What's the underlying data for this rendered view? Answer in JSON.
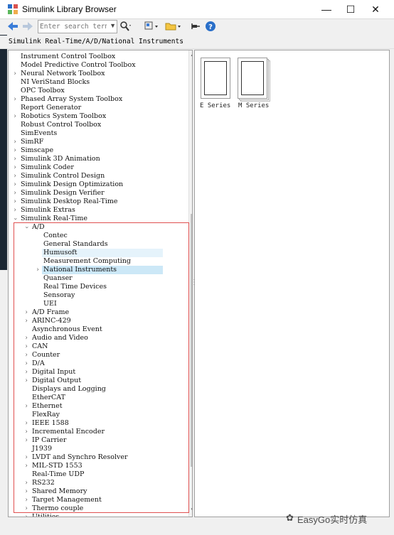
{
  "window": {
    "title": "Simulink Library Browser",
    "minimize": "—",
    "maximize": "☐",
    "close": "✕"
  },
  "toolbar": {
    "search_placeholder": "Enter search term",
    "icons": [
      "back-arrow-icon",
      "forward-arrow-icon",
      "search-options-icon",
      "refresh-icon",
      "folder-icon",
      "pin-icon",
      "help-icon"
    ]
  },
  "path": "Simulink Real-Time/A/D/National Instruments",
  "tree": {
    "items": [
      {
        "label": "Instrument Control Toolbox",
        "level": 0,
        "arrow": "none"
      },
      {
        "label": "Model Predictive Control Toolbox",
        "level": 0,
        "arrow": "none"
      },
      {
        "label": "Neural Network Toolbox",
        "level": 0,
        "arrow": "closed"
      },
      {
        "label": "NI VeriStand Blocks",
        "level": 0,
        "arrow": "none"
      },
      {
        "label": "OPC Toolbox",
        "level": 0,
        "arrow": "none"
      },
      {
        "label": "Phased Array System Toolbox",
        "level": 0,
        "arrow": "closed"
      },
      {
        "label": "Report Generator",
        "level": 0,
        "arrow": "none"
      },
      {
        "label": "Robotics System Toolbox",
        "level": 0,
        "arrow": "closed"
      },
      {
        "label": "Robust Control Toolbox",
        "level": 0,
        "arrow": "none"
      },
      {
        "label": "SimEvents",
        "level": 0,
        "arrow": "none"
      },
      {
        "label": "SimRF",
        "level": 0,
        "arrow": "closed"
      },
      {
        "label": "Simscape",
        "level": 0,
        "arrow": "closed"
      },
      {
        "label": "Simulink 3D Animation",
        "level": 0,
        "arrow": "closed"
      },
      {
        "label": "Simulink Coder",
        "level": 0,
        "arrow": "closed"
      },
      {
        "label": "Simulink Control Design",
        "level": 0,
        "arrow": "closed"
      },
      {
        "label": "Simulink Design Optimization",
        "level": 0,
        "arrow": "closed"
      },
      {
        "label": "Simulink Design Verifier",
        "level": 0,
        "arrow": "closed"
      },
      {
        "label": "Simulink Desktop Real-Time",
        "level": 0,
        "arrow": "closed"
      },
      {
        "label": "Simulink Extras",
        "level": 0,
        "arrow": "closed"
      },
      {
        "label": "Simulink Real-Time",
        "level": 0,
        "arrow": "open"
      },
      {
        "label": "A/D",
        "level": 1,
        "arrow": "open"
      },
      {
        "label": "Contec",
        "level": 2,
        "arrow": "none"
      },
      {
        "label": "General Standards",
        "level": 2,
        "arrow": "none"
      },
      {
        "label": "Humusoft",
        "level": 2,
        "arrow": "none",
        "highlight": "light"
      },
      {
        "label": "Measurement Computing",
        "level": 2,
        "arrow": "none"
      },
      {
        "label": "National Instruments",
        "level": 2,
        "arrow": "closed",
        "highlight": "selected"
      },
      {
        "label": "Quanser",
        "level": 2,
        "arrow": "none"
      },
      {
        "label": "Real Time Devices",
        "level": 2,
        "arrow": "none"
      },
      {
        "label": "Sensoray",
        "level": 2,
        "arrow": "none"
      },
      {
        "label": "UEI",
        "level": 2,
        "arrow": "none"
      },
      {
        "label": "A/D Frame",
        "level": 1,
        "arrow": "closed"
      },
      {
        "label": "ARINC-429",
        "level": 1,
        "arrow": "closed"
      },
      {
        "label": "Asynchronous Event",
        "level": 1,
        "arrow": "none"
      },
      {
        "label": "Audio and Video",
        "level": 1,
        "arrow": "closed"
      },
      {
        "label": "CAN",
        "level": 1,
        "arrow": "closed"
      },
      {
        "label": "Counter",
        "level": 1,
        "arrow": "closed"
      },
      {
        "label": "D/A",
        "level": 1,
        "arrow": "closed"
      },
      {
        "label": "Digital Input",
        "level": 1,
        "arrow": "closed"
      },
      {
        "label": "Digital Output",
        "level": 1,
        "arrow": "closed"
      },
      {
        "label": "Displays and Logging",
        "level": 1,
        "arrow": "none"
      },
      {
        "label": "EtherCAT",
        "level": 1,
        "arrow": "none"
      },
      {
        "label": "Ethernet",
        "level": 1,
        "arrow": "closed"
      },
      {
        "label": "FlexRay",
        "level": 1,
        "arrow": "none"
      },
      {
        "label": "IEEE 1588",
        "level": 1,
        "arrow": "closed"
      },
      {
        "label": "Incremental Encoder",
        "level": 1,
        "arrow": "closed"
      },
      {
        "label": "IP Carrier",
        "level": 1,
        "arrow": "closed"
      },
      {
        "label": "J1939",
        "level": 1,
        "arrow": "none"
      },
      {
        "label": "LVDT and Synchro Resolver",
        "level": 1,
        "arrow": "closed"
      },
      {
        "label": "MIL-STD 1553",
        "level": 1,
        "arrow": "closed"
      },
      {
        "label": "Real-Time UDP",
        "level": 1,
        "arrow": "none"
      },
      {
        "label": "RS232",
        "level": 1,
        "arrow": "closed"
      },
      {
        "label": "Shared Memory",
        "level": 1,
        "arrow": "closed"
      },
      {
        "label": "Target Management",
        "level": 1,
        "arrow": "closed"
      },
      {
        "label": "Thermo couple",
        "level": 1,
        "arrow": "closed"
      },
      {
        "label": "Utilities",
        "level": 1,
        "arrow": "closed"
      }
    ]
  },
  "blocks": [
    {
      "label": "E Series"
    },
    {
      "label": "M Series"
    }
  ],
  "watermark": "EasyGo实时仿真",
  "colors": {
    "selected": "#cce8f7",
    "hover": "#e5f3fb",
    "annotation_box": "#e05050"
  }
}
